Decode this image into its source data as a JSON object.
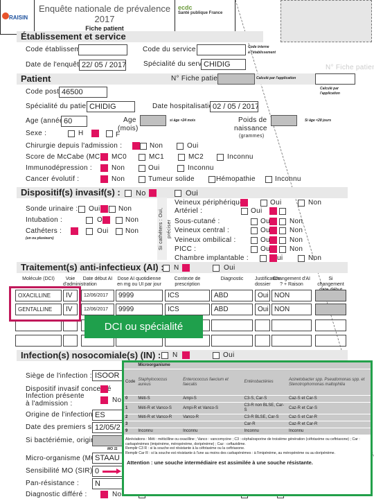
{
  "header": {
    "title_line1": "Enquête nationale de prévalence",
    "title_line2": "2017",
    "subtitle": "Fiche patient",
    "logo_left": "RAISIN",
    "logo_right_1": "Santé publique France",
    "logo_right_2": "ecdc"
  },
  "etablissement": {
    "section_title": "Établissement et service",
    "code_etab_label": "Code établissement",
    "code_etab_value": "",
    "code_service_label": "Code du service",
    "code_service_value": "",
    "code_service_note1": "Code interne",
    "code_service_note2": "à l'établissement",
    "date_enquete_label": "Date de l'enquête",
    "date_enquete_value": "22/ 05 / 2017",
    "specialite_service_label": "Spécialité du service",
    "specialite_service_value": "CHIDIG",
    "faded_fiche": "N° Fiche patien"
  },
  "patient": {
    "section_title": "Patient",
    "fiche_label": "N° Fiche patient",
    "fiche_note": "Calculé par l'application",
    "side_note1": "Calculé par",
    "side_note2": "l'application",
    "code_postal_label": "Code postal",
    "code_postal_value": "46500",
    "specialite_label": "Spécialité du patient",
    "specialite_value": "CHIDIG",
    "date_hosp_label": "Date hospitalisation",
    "date_hosp_value": "02 / 05 / 2017",
    "age_label": "Age (années)",
    "age_value": "60",
    "age_mois_label1": "Age",
    "age_mois_label2": "(mois)",
    "age_mois_note": "si âge <24 mois",
    "poids_label1": "Poids de",
    "poids_label2": "naissance",
    "poids_label3": "(grammes)",
    "poids_note": "Si âge <28 jours",
    "sexe_label": "Sexe :",
    "sexe_h": "H",
    "sexe_f": "F",
    "chirurgie_label": "Chirurgie depuis l'admission :",
    "non": "Non",
    "oui": "Oui",
    "inconnu": "Inconnu",
    "mccabe_label": "Score de McCabe (MC) :",
    "mc0": "MC0",
    "mc1": "MC1",
    "mc2": "MC2",
    "immuno_label": "Immunodépression :",
    "cancer_label": "Cancer évolutif :",
    "tumeur": "Tumeur solide",
    "hemopathie": "Hémopathie"
  },
  "dispositifs": {
    "section_title": "Dispositif(s) invasif(s) :",
    "no": "No",
    "oui": "Oui",
    "non": "Non",
    "o": "O",
    "ou": "Ou",
    "ui": "ui",
    "sonde": "Sonde urinaire :",
    "intubation": "Intubation :",
    "catheters": "Cathéters :",
    "catheters_note": "(un ou plusieurs)",
    "vertical_note": "Si cathéters : Oui, préciser",
    "periph": "Veineux périphérique",
    "arteriel": "Artériel :",
    "sous_cutane": "Sous-cutané :",
    "central": "Veineux central :",
    "ombilical": "Veineux ombilical :",
    "picc": "PICC :",
    "chambre": "Chambre implantable :"
  },
  "traitement": {
    "section_title": "Traitement(s) anti-infectieux (AI) :",
    "n": "N",
    "oui": "Oui",
    "columns": [
      "Molécule (DCI)",
      "Voie d'administration",
      "Date début AI",
      "Dose AI quotidienne en mg ou UI par jour",
      "Contexte de prescription",
      "Diagnostic",
      "Justification dossier",
      "Changement d'AI ? + Raison",
      "Si changement date début 1er AI"
    ],
    "rows": [
      [
        "OXACILLINE",
        "IV",
        "12/06/2017",
        "9999",
        "ICS",
        "ABD",
        "Oui",
        "NON",
        ""
      ],
      [
        "GENTALLINE",
        "IV",
        "12/06/2017",
        "9999",
        "ICS",
        "ABD",
        "Oui",
        "NON",
        ""
      ],
      [
        "",
        "",
        "",
        "",
        "",
        "",
        "",
        "",
        ""
      ],
      [
        "",
        "",
        "",
        "",
        "",
        "",
        "",
        "",
        ""
      ]
    ],
    "callout": "DCI ou spécialité",
    "callout_color": "#1fa04c",
    "highlight_color": "#c0185a"
  },
  "infection": {
    "section_title": "Infection(s) nosocomiale(s) (IN) :",
    "n": "N",
    "oui": "Oui",
    "non": "Non",
    "siege_label": "Siège de l'infection :",
    "siege_value": "ISOOR",
    "dispositif_label": "Dispositif invasif concerné",
    "presente_label1": "Infection présente",
    "presente_label2": "à l'admission :",
    "origine_label": "Origine de l'infection :",
    "origine_value": "ES",
    "date_label": "Date des premiers signes",
    "date_value": "12/05/2",
    "bacteriemie_label": "Si bactériémie, origine",
    "mo_hint": "MO 11",
    "mo_label": "Micro-organisme (MO) :",
    "mo_value": "STAAU",
    "sir_label": "Sensibilité MO (SIR) :",
    "sir_value": "0",
    "pan_label": "Pan-résistance :",
    "pan_value": "N",
    "diag_label": "Diagnostic différé :"
  },
  "legend_table": {
    "title": "Microorganisme",
    "code_header": "Code",
    "headers": [
      "Staphylococcus aureus",
      "Enterococcus faecium et faecalis",
      "Entérobactéries",
      "Acinetobacter spp. Pseudomonas spp. et Stenotrophomonas maltophilia"
    ],
    "rows": [
      [
        "0",
        "Méti-S",
        "Ampi-S",
        "C3-S, Car-S",
        "Caz-S et Car-S"
      ],
      [
        "1",
        "Méti-R et Vanco-S",
        "Ampi-R et Vanco-S",
        "C3-R non BLSE, Car-S",
        "Caz-R et Car-S"
      ],
      [
        "2",
        "Méti-R et Vanco-R",
        "Vanco-R",
        "C3-R BLSE, Car-S",
        "Caz-S et Car-R"
      ],
      [
        "3",
        "",
        "",
        "Car-R",
        "Caz-R et Car-R"
      ],
      [
        "9",
        "Inconnu",
        "Inconnu",
        "Inconnu",
        "Inconnu"
      ]
    ],
    "notes": [
      "Abréviations : Méti : méticilline ou oxacilline ; Vanco : vancomycine ; C3 : céphalosporine de troisième génération (céfotaxime ou ceftriaxone) ; Car : carbapénèmes (imipénème, méropénème, doripénème) ; Caz : ceftazidime.",
      "Remplir C3 R : si la souche est résistante à la céfotaxime ou la ceftriaxone.",
      "Remplir Car R : si la souche est résistante à l'une au moins des carbapénèmes : à l'imipénème, au méropénème ou au doripénème."
    ],
    "attention": "Attention : une souche intermédiaire est assimilée à une souche résistante.",
    "border_color": "#22a04a"
  },
  "colors": {
    "checked": "#e0115f",
    "section_bg": "#e8e8e8",
    "readonly": "#c0c0c0"
  }
}
